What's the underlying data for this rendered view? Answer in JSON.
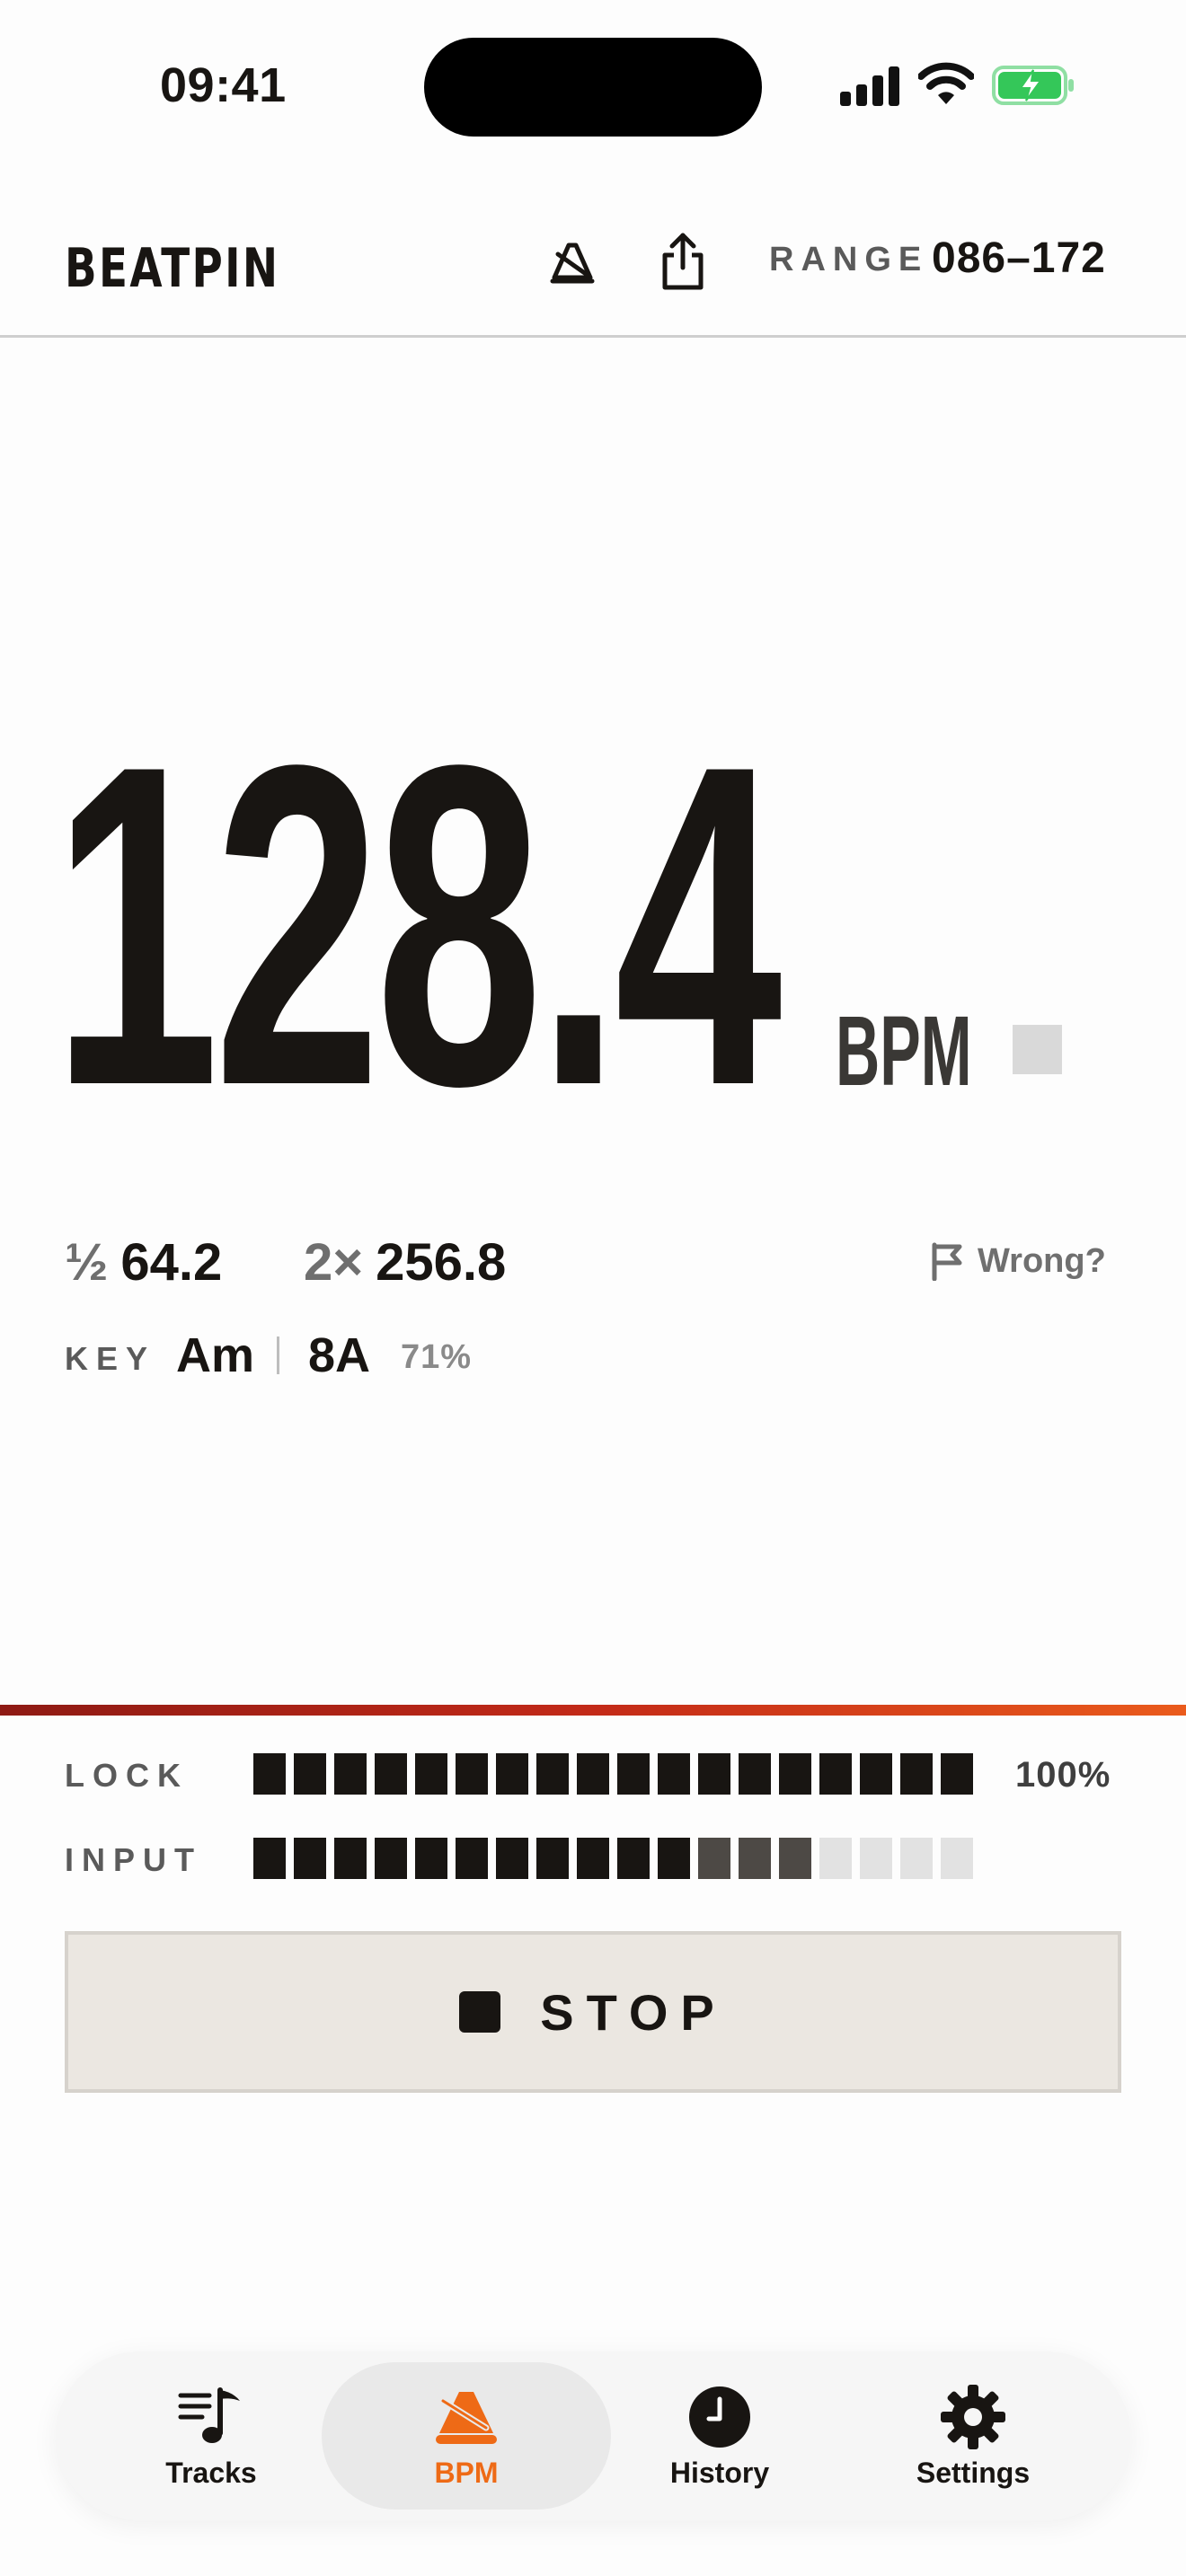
{
  "status_bar": {
    "time": "09:41",
    "icons": [
      "cellular-signal-icon",
      "wifi-icon",
      "battery-charging-icon"
    ],
    "battery_color": "#34c759"
  },
  "header": {
    "brand": "BEATPIN",
    "range_label": "RANGE",
    "range_value": "086–172",
    "icons": [
      "metronome-off-icon",
      "share-icon"
    ]
  },
  "reading": {
    "bpm": "128.4",
    "unit": "BPM",
    "half_prefix": "½",
    "half_value": "64.2",
    "double_prefix": "2×",
    "double_value": "256.8",
    "wrong_label": "Wrong?",
    "key_label": "KEY",
    "key_name": "Am",
    "key_camelot": "8A",
    "key_confidence": "71%"
  },
  "meters": {
    "lock_label": "LOCK",
    "lock_percent": "100%",
    "lock_level": 1.0,
    "input_label": "INPUT",
    "input_level": 0.78,
    "segments": 18
  },
  "controls": {
    "stop_label": "STOP"
  },
  "tabs": [
    {
      "label": "Tracks",
      "icon": "music-list-icon",
      "active": false
    },
    {
      "label": "BPM",
      "icon": "metronome-icon",
      "active": true
    },
    {
      "label": "History",
      "icon": "clock-icon",
      "active": false
    },
    {
      "label": "Settings",
      "icon": "gear-icon",
      "active": false
    }
  ],
  "colors": {
    "accent": "#ee6a16",
    "ink": "#181512",
    "gradient_start": "#8e1a14",
    "gradient_end": "#ea5b1c"
  }
}
